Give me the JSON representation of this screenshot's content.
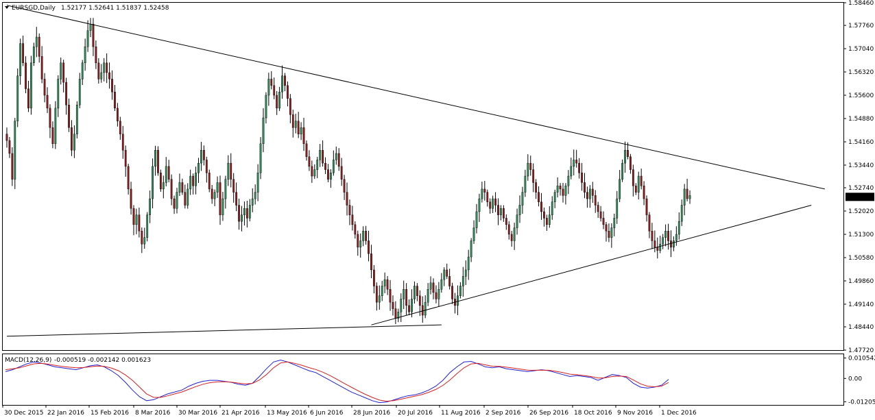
{
  "window": {
    "symbol_label": "EURSGD,Daily",
    "ohlc_text": "1.52177 1.52641 1.51837 1.52458",
    "current_price_label": "1.52458"
  },
  "colors": {
    "bull": "#2e8b57",
    "bear": "#8b1a1a",
    "wick": "#000000",
    "macd_line": "#1f1fd6",
    "signal_line": "#d61f1f",
    "trendline": "#000000",
    "price_marker_bg": "#000000",
    "price_marker_fg": "#ffffff"
  },
  "chart_data": [
    {
      "type": "candlestick",
      "title": "EURSGD,Daily",
      "ylim": [
        1.4772,
        1.5846
      ],
      "y_ticks": [
        "1.58460",
        "1.57760",
        "1.57040",
        "1.56320",
        "1.55600",
        "1.54880",
        "1.54160",
        "1.53440",
        "1.52740",
        "1.52020",
        "1.51300",
        "1.50580",
        "1.49860",
        "1.49140",
        "1.48440",
        "1.47720"
      ],
      "y_tick_values": [
        1.5846,
        1.5776,
        1.5704,
        1.5632,
        1.556,
        1.5488,
        1.5416,
        1.5344,
        1.5274,
        1.5202,
        1.513,
        1.5058,
        1.4986,
        1.4914,
        1.4844,
        1.4772
      ],
      "x_ticks": [
        "30 Dec 2015",
        "22 Jan 2016",
        "15 Feb 2016",
        "8 Mar 2016",
        "30 Mar 2016",
        "21 Apr 2016",
        "13 May 2016",
        "6 Jun 2016",
        "28 Jun 2016",
        "20 Jul 2016",
        "11 Aug 2016",
        "2 Sep 2016",
        "26 Sep 2016",
        "18 Oct 2016",
        "9 Nov 2016",
        "1 Dec 2016"
      ],
      "last_close": 1.52458,
      "grid": false,
      "closes": [
        1.542,
        1.538,
        1.53,
        1.548,
        1.562,
        1.572,
        1.566,
        1.558,
        1.552,
        1.566,
        1.571,
        1.574,
        1.568,
        1.561,
        1.556,
        1.552,
        1.546,
        1.541,
        1.552,
        1.561,
        1.566,
        1.56,
        1.553,
        1.546,
        1.539,
        1.544,
        1.553,
        1.561,
        1.566,
        1.571,
        1.576,
        1.578,
        1.571,
        1.566,
        1.561,
        1.563,
        1.566,
        1.563,
        1.561,
        1.557,
        1.552,
        1.548,
        1.544,
        1.539,
        1.534,
        1.527,
        1.521,
        1.516,
        1.519,
        1.514,
        1.51,
        1.512,
        1.519,
        1.524,
        1.534,
        1.539,
        1.532,
        1.527,
        1.529,
        1.534,
        1.53,
        1.524,
        1.521,
        1.526,
        1.529,
        1.526,
        1.522,
        1.527,
        1.531,
        1.528,
        1.532,
        1.535,
        1.539,
        1.536,
        1.532,
        1.527,
        1.524,
        1.526,
        1.529,
        1.519,
        1.524,
        1.53,
        1.535,
        1.53,
        1.526,
        1.522,
        1.517,
        1.519,
        1.521,
        1.518,
        1.522,
        1.524,
        1.526,
        1.532,
        1.541,
        1.549,
        1.556,
        1.561,
        1.559,
        1.556,
        1.552,
        1.557,
        1.562,
        1.559,
        1.555,
        1.55,
        1.546,
        1.548,
        1.544,
        1.546,
        1.541,
        1.537,
        1.534,
        1.531,
        1.533,
        1.536,
        1.539,
        1.535,
        1.533,
        1.53,
        1.532,
        1.536,
        1.538,
        1.534,
        1.53,
        1.526,
        1.522,
        1.519,
        1.516,
        1.513,
        1.509,
        1.511,
        1.514,
        1.511,
        1.507,
        1.502,
        1.497,
        1.492,
        1.494,
        1.497,
        1.499,
        1.496,
        1.492,
        1.49,
        1.487,
        1.489,
        1.493,
        1.496,
        1.491,
        1.489,
        1.493,
        1.497,
        1.494,
        1.491,
        1.488,
        1.492,
        1.496,
        1.498,
        1.495,
        1.493,
        1.496,
        1.499,
        1.502,
        1.5,
        1.497,
        1.493,
        1.491,
        1.494,
        1.497,
        1.5,
        1.502,
        1.506,
        1.511,
        1.515,
        1.52,
        1.524,
        1.527,
        1.526,
        1.523,
        1.521,
        1.524,
        1.522,
        1.519,
        1.521,
        1.518,
        1.516,
        1.513,
        1.511,
        1.515,
        1.519,
        1.522,
        1.526,
        1.531,
        1.535,
        1.533,
        1.529,
        1.526,
        1.523,
        1.52,
        1.518,
        1.516,
        1.519,
        1.523,
        1.526,
        1.528,
        1.527,
        1.525,
        1.528,
        1.531,
        1.534,
        1.536,
        1.535,
        1.532,
        1.529,
        1.526,
        1.524,
        1.527,
        1.525,
        1.522,
        1.52,
        1.518,
        1.516,
        1.514,
        1.512,
        1.515,
        1.518,
        1.524,
        1.53,
        1.535,
        1.539,
        1.537,
        1.533,
        1.528,
        1.526,
        1.531,
        1.528,
        1.524,
        1.519,
        1.514,
        1.511,
        1.509,
        1.508,
        1.51,
        1.512,
        1.514,
        1.511,
        1.509,
        1.511,
        1.513,
        1.517,
        1.522,
        1.527,
        1.524,
        1.525
      ],
      "highs_lows_note": "",
      "trendlines": [
        {
          "from_x": 0,
          "from_y": 1.5838,
          "to_x": 303,
          "to_y": 1.527
        },
        {
          "from_x": 135,
          "from_y": 1.485,
          "to_x": 298,
          "to_y": 1.522
        },
        {
          "from_x": 0,
          "from_y": 1.4815,
          "to_x": 161,
          "to_y": 1.485
        }
      ]
    },
    {
      "type": "line",
      "title": "MACD(12,26,9)",
      "values_text": "-0.000519 -0.002142 0.001623",
      "ylim": [
        -0.0137,
        0.0125
      ],
      "y_ticks": [
        "0.010542",
        "0.00",
        "-0.01205"
      ],
      "y_tick_values": [
        0.010542,
        0.0,
        -0.01205
      ],
      "series": [
        {
          "name": "MACD",
          "values": [
            0.0035,
            0.0045,
            0.006,
            0.0075,
            0.0085,
            0.008,
            0.007,
            0.006,
            0.0055,
            0.005,
            0.0045,
            0.0055,
            0.0065,
            0.007,
            0.006,
            0.004,
            0.0015,
            -0.002,
            -0.006,
            -0.0095,
            -0.0115,
            -0.011,
            -0.0095,
            -0.008,
            -0.007,
            -0.006,
            -0.004,
            -0.0025,
            -0.0015,
            -0.001,
            -0.001,
            -0.0015,
            -0.002,
            -0.003,
            -0.0035,
            -0.0025,
            0.001,
            0.005,
            0.0085,
            0.0095,
            0.0085,
            0.007,
            0.0055,
            0.004,
            0.003,
            0.001,
            -0.001,
            -0.003,
            -0.005,
            -0.007,
            -0.0085,
            -0.01,
            -0.0115,
            -0.0125,
            -0.0122,
            -0.0112,
            -0.01,
            -0.009,
            -0.0085,
            -0.0075,
            -0.006,
            -0.004,
            -0.001,
            0.003,
            0.006,
            0.0085,
            0.0088,
            0.0075,
            0.006,
            0.0055,
            0.006,
            0.005,
            0.0045,
            0.004,
            0.0035,
            0.004,
            0.0045,
            0.004,
            0.003,
            0.002,
            0.001,
            0.0015,
            0.001,
            0.0005,
            -0.001,
            0.0005,
            0.002,
            0.0015,
            0.0005,
            -0.0025,
            -0.0045,
            -0.005,
            -0.0045,
            -0.0035,
            -0.0005
          ]
        },
        {
          "name": "Signal",
          "values": [
            0.0045,
            0.005,
            0.0055,
            0.0065,
            0.0075,
            0.0078,
            0.0074,
            0.0068,
            0.0062,
            0.0058,
            0.0055,
            0.0056,
            0.006,
            0.0064,
            0.0062,
            0.0054,
            0.004,
            0.0018,
            -0.001,
            -0.0045,
            -0.008,
            -0.0098,
            -0.0098,
            -0.009,
            -0.008,
            -0.007,
            -0.0056,
            -0.0042,
            -0.003,
            -0.0022,
            -0.0018,
            -0.0017,
            -0.0019,
            -0.0024,
            -0.0028,
            -0.0026,
            -0.0008,
            0.002,
            0.0055,
            0.008,
            0.0085,
            0.0078,
            0.0068,
            0.0056,
            0.0046,
            0.0032,
            0.0015,
            -0.0005,
            -0.0025,
            -0.0045,
            -0.0064,
            -0.0082,
            -0.0098,
            -0.0112,
            -0.0118,
            -0.0115,
            -0.0108,
            -0.01,
            -0.0092,
            -0.0084,
            -0.0072,
            -0.0057,
            -0.0036,
            -0.0008,
            0.0025,
            0.0055,
            0.0075,
            0.0078,
            0.007,
            0.0063,
            0.0062,
            0.0058,
            0.0053,
            0.0048,
            0.0043,
            0.0042,
            0.0043,
            0.0042,
            0.0037,
            0.003,
            0.0022,
            0.0019,
            0.0015,
            0.001,
            0.0002,
            0.0003,
            0.001,
            0.0012,
            0.001,
            -0.0008,
            -0.0028,
            -0.004,
            -0.0043,
            -0.004,
            -0.0021
          ]
        }
      ]
    }
  ]
}
